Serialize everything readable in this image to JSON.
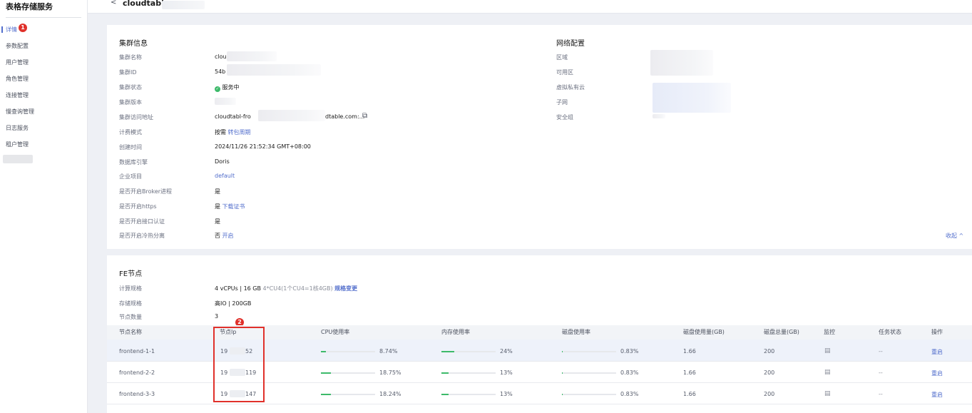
{
  "sidebar": {
    "title": "表格存储服务",
    "items": [
      "详情",
      "参数配置",
      "用户管理",
      "角色管理",
      "连接管理",
      "慢查询管理",
      "日志服务",
      "租户管理"
    ],
    "badge": "1"
  },
  "header": {
    "back": "<",
    "title": "cloudtabl"
  },
  "cluster": {
    "section_title": "集群信息",
    "fields": [
      {
        "label": "集群名称",
        "value": "clou"
      },
      {
        "label": "集群ID",
        "value": "54b"
      },
      {
        "label": "集群状态",
        "value": "服务中"
      },
      {
        "label": "集群版本",
        "value": ""
      },
      {
        "label": "集群访问地址",
        "value_prefix": "cloudtabl-fro",
        "value_suffix": "dtable.com:..."
      },
      {
        "label": "计费模式",
        "value": "按需",
        "link": "转包周期"
      },
      {
        "label": "创建时间",
        "value": "2024/11/26 21:52:34 GMT+08:00"
      },
      {
        "label": "数据库引擎",
        "value": "Doris"
      },
      {
        "label": "企业项目",
        "link": "default"
      },
      {
        "label": "是否开启Broker进程",
        "value": "是"
      },
      {
        "label": "是否开启https",
        "value": "是",
        "link": "下载证书"
      },
      {
        "label": "是否开启接口认证",
        "value": "是"
      },
      {
        "label": "是否开启冷热分离",
        "value": "否",
        "link": "开启"
      }
    ],
    "collapse": "收起 ^"
  },
  "network": {
    "section_title": "网络配置",
    "labels": [
      "区域",
      "可用区",
      "虚拟私有云",
      "子网",
      "安全组"
    ]
  },
  "fe": {
    "section_title": "FE节点",
    "spec_label": "计算规格",
    "spec_value": "4 vCPUs | 16 GB",
    "spec_note": "4*CU4(1个CU4=1核4GB)",
    "spec_link": "规格变更",
    "storage_label": "存储规格",
    "storage_value": "高IO | 200GB",
    "count_label": "节点数量",
    "count_value": "3",
    "badge": "2",
    "columns": [
      "节点名称",
      "节点Ip",
      "CPU使用率",
      "内存使用率",
      "磁盘使用率",
      "磁盘使用量(GB)",
      "磁盘总量(GB)",
      "监控",
      "任务状态",
      "操作"
    ],
    "rows": [
      {
        "name": "frontend-1-1",
        "ip_a": "19",
        "ip_b": "52",
        "cpu": "8.74%",
        "cpu_v": 8.74,
        "mem": "24%",
        "mem_v": 24,
        "disk": "0.83%",
        "disk_v": 0.83,
        "disk_used": "1.66",
        "disk_total": "200",
        "status": "--",
        "action": "重启"
      },
      {
        "name": "frontend-2-2",
        "ip_a": "19",
        "ip_b": "119",
        "cpu": "18.75%",
        "cpu_v": 18.75,
        "mem": "13%",
        "mem_v": 13,
        "disk": "0.83%",
        "disk_v": 0.83,
        "disk_used": "1.66",
        "disk_total": "200",
        "status": "--",
        "action": "重启"
      },
      {
        "name": "frontend-3-3",
        "ip_a": "19",
        "ip_b": "147",
        "cpu": "18.24%",
        "cpu_v": 18.24,
        "mem": "13%",
        "mem_v": 13,
        "disk": "0.83%",
        "disk_v": 0.83,
        "disk_used": "1.66",
        "disk_total": "200",
        "status": "--",
        "action": "重启"
      }
    ]
  },
  "colors": {
    "accent": "#526ecc",
    "success": "#3dba6a",
    "badge": "#e0312b"
  }
}
